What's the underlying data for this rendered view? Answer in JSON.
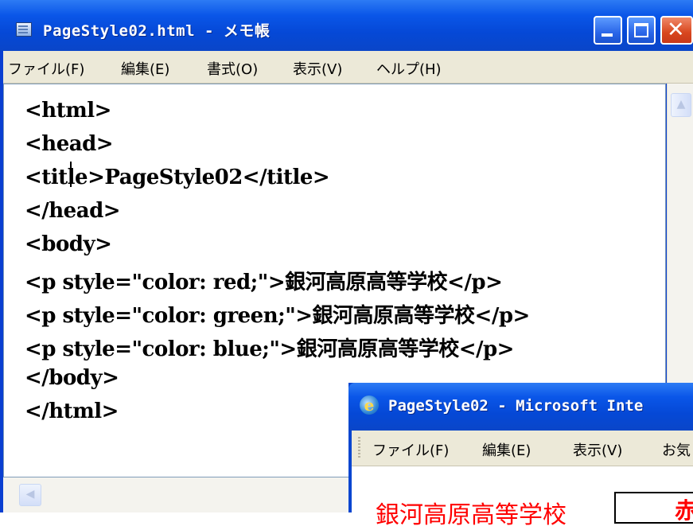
{
  "notepad": {
    "title": "PageStyle02.html - メモ帳",
    "menus": [
      "ファイル(F)",
      "編集(E)",
      "書式(O)",
      "表示(V)",
      "ヘルプ(H)"
    ],
    "lines": [
      "<html>",
      "<head>",
      "<title>PageStyle02</title>",
      "</head>",
      "<body>",
      "<p style=\"color: red;\">銀河高原高等学校</p>",
      "<p style=\"color: green;\">銀河高原高等学校</p>",
      "<p style=\"color: blue;\">銀河高原高等学校</p>",
      "</body>",
      "</html>"
    ]
  },
  "ie": {
    "title": "PageStyle02 - Microsoft Inte",
    "menus": [
      "ファイル(F)",
      "編集(E)",
      "表示(V)",
      "お気"
    ],
    "content_text": "銀河高原高等学校",
    "box_label": "赤",
    "text_color": "#ff0000"
  },
  "colors": {
    "titlebar": "#0a56e8",
    "menubar": "#ece9d8",
    "close_button": "#d8461e"
  }
}
